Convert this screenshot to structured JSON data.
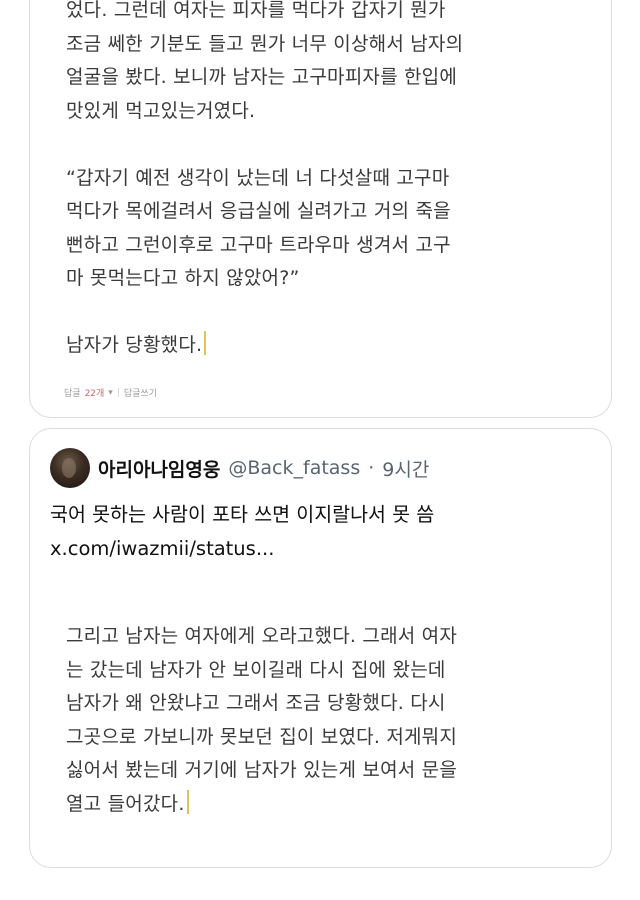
{
  "top_card": {
    "paragraphs": [
      [
        "었다. 그런데 여자는 피자를 먹다가 갑자기 뭔가",
        "조금 쎄한 기분도 들고 뭔가 너무 이상해서 남자의",
        "얼굴을 봤다. 보니까 남자는 고구마피자를 한입에",
        "맛있게 먹고있는거였다."
      ],
      [
        "“갑자기 예전 생각이 났는데 너 다섯살때 고구마",
        "먹다가 목에걸려서 응급실에 실려가고 거의 죽을",
        "뻔하고 그런이후로 고구마 트라우마 생겨서 고구",
        "마 못먹는다고 하지 않았어?”"
      ],
      [
        "남자가 당황했다."
      ]
    ],
    "reply_label": "답글",
    "reply_count": "22개",
    "reply_toggle": "▾",
    "write_reply": "답글쓰기"
  },
  "tweet": {
    "display_name": "아리아나임영웅",
    "handle": "@Back_fatass",
    "separator": "·",
    "time": "9시간",
    "text": "국어 못하는 사람이 포타 쓰면 이지랄나서 못 씀",
    "link": "x.com/iwazmii/status..."
  },
  "bottom_card": {
    "lines": [
      "그리고 남자는 여자에게 오라고했다. 그래서 여자",
      "는 갔는데 남자가 안 보이길래 다시 집에 왔는데",
      "남자가 왜 안왔냐고 그래서 조금 당황했다. 다시",
      "그곳으로 가보니까 못보던 집이 보였다. 저게뭐지",
      "싫어서 봤는데 거기에 남자가 있는게 보여서 문을",
      "열고 들어갔다."
    ]
  }
}
